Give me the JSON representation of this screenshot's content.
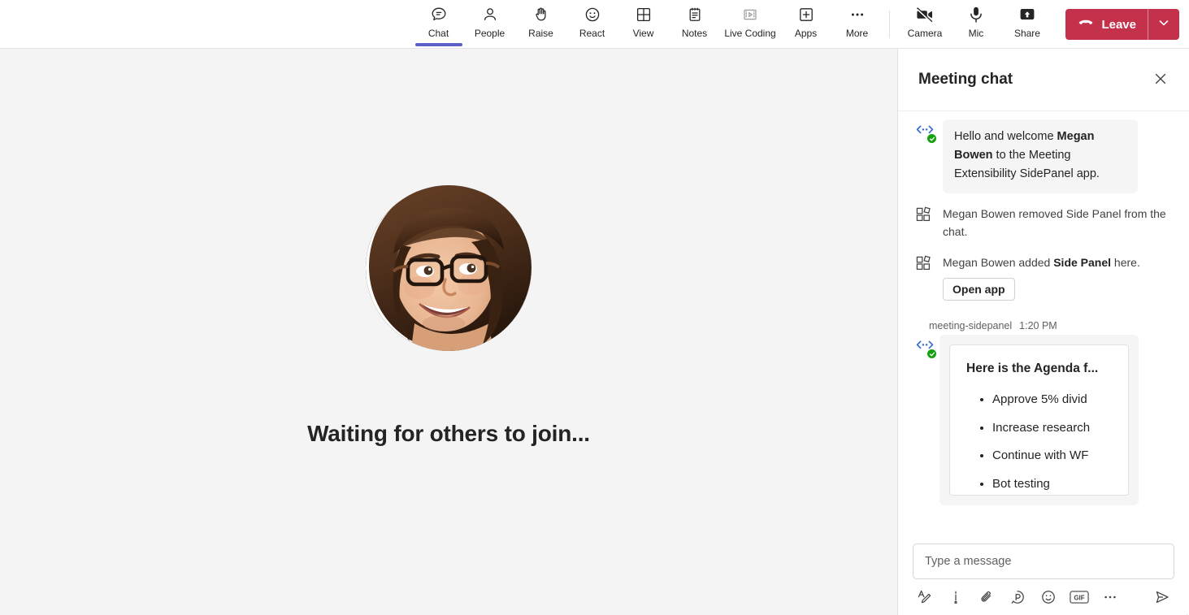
{
  "toolbar": {
    "items": [
      {
        "label": "Chat",
        "icon": "chat-icon",
        "active": true
      },
      {
        "label": "People",
        "icon": "people-icon",
        "active": false
      },
      {
        "label": "Raise",
        "icon": "raise-hand-icon",
        "active": false
      },
      {
        "label": "React",
        "icon": "react-emoji-icon",
        "active": false
      },
      {
        "label": "View",
        "icon": "view-grid-icon",
        "active": false
      },
      {
        "label": "Notes",
        "icon": "notes-icon",
        "active": false
      },
      {
        "label": "Live Coding",
        "icon": "live-coding-icon",
        "active": false
      },
      {
        "label": "Apps",
        "icon": "apps-plus-icon",
        "active": false
      },
      {
        "label": "More",
        "icon": "more-ellipsis-icon",
        "active": false
      }
    ],
    "controls": [
      {
        "label": "Camera",
        "icon": "camera-off-icon"
      },
      {
        "label": "Mic",
        "icon": "mic-icon"
      },
      {
        "label": "Share",
        "icon": "share-screen-icon"
      }
    ],
    "leave": {
      "label": "Leave",
      "icon": "hang-up-icon",
      "caret_icon": "chevron-down-icon",
      "color": "#c4314b"
    },
    "active_indicator_color": "#5b5fc7"
  },
  "stage": {
    "caption": "Waiting for others to join...",
    "avatar_name": "participant-avatar",
    "background": "#f4f4f4"
  },
  "chat": {
    "title": "Meeting chat",
    "close_icon": "close-icon",
    "messages": [
      {
        "type": "bot-bubble",
        "avatar_icon": "bot-code-icon",
        "verified": true,
        "text_parts": [
          {
            "text": "Hello and welcome ",
            "bold": false
          },
          {
            "text": "Megan Bowen",
            "bold": true
          },
          {
            "text": " to the Meeting Extensibility SidePanel app.",
            "bold": false
          }
        ]
      },
      {
        "type": "system",
        "icon": "apps-grid-icon",
        "text_parts": [
          {
            "text": "Megan Bowen removed Side Panel from the chat.",
            "bold": false
          }
        ]
      },
      {
        "type": "system",
        "icon": "apps-grid-icon",
        "text_parts": [
          {
            "text": "Megan Bowen added ",
            "bold": false
          },
          {
            "text": "Side Panel",
            "bold": true
          },
          {
            "text": " here.",
            "bold": false
          }
        ],
        "button_label": "Open app"
      }
    ],
    "card_message": {
      "sender": "meeting-sidepanel",
      "timestamp": "1:20 PM",
      "avatar_icon": "bot-code-icon",
      "verified": true,
      "card_title": "Here is the Agenda f...",
      "card_items": [
        "Approve 5% divid",
        "Increase research",
        "Continue with WF",
        "Bot testing"
      ]
    }
  },
  "compose": {
    "placeholder": "Type a message",
    "value": "",
    "tools": [
      {
        "name": "format-text-icon"
      },
      {
        "name": "important-icon"
      },
      {
        "name": "attach-file-icon"
      },
      {
        "name": "loop-component-icon"
      },
      {
        "name": "emoji-icon"
      },
      {
        "name": "gif-icon"
      },
      {
        "name": "more-options-icon"
      }
    ],
    "gif_label": "GIF",
    "send_icon": "send-icon"
  }
}
